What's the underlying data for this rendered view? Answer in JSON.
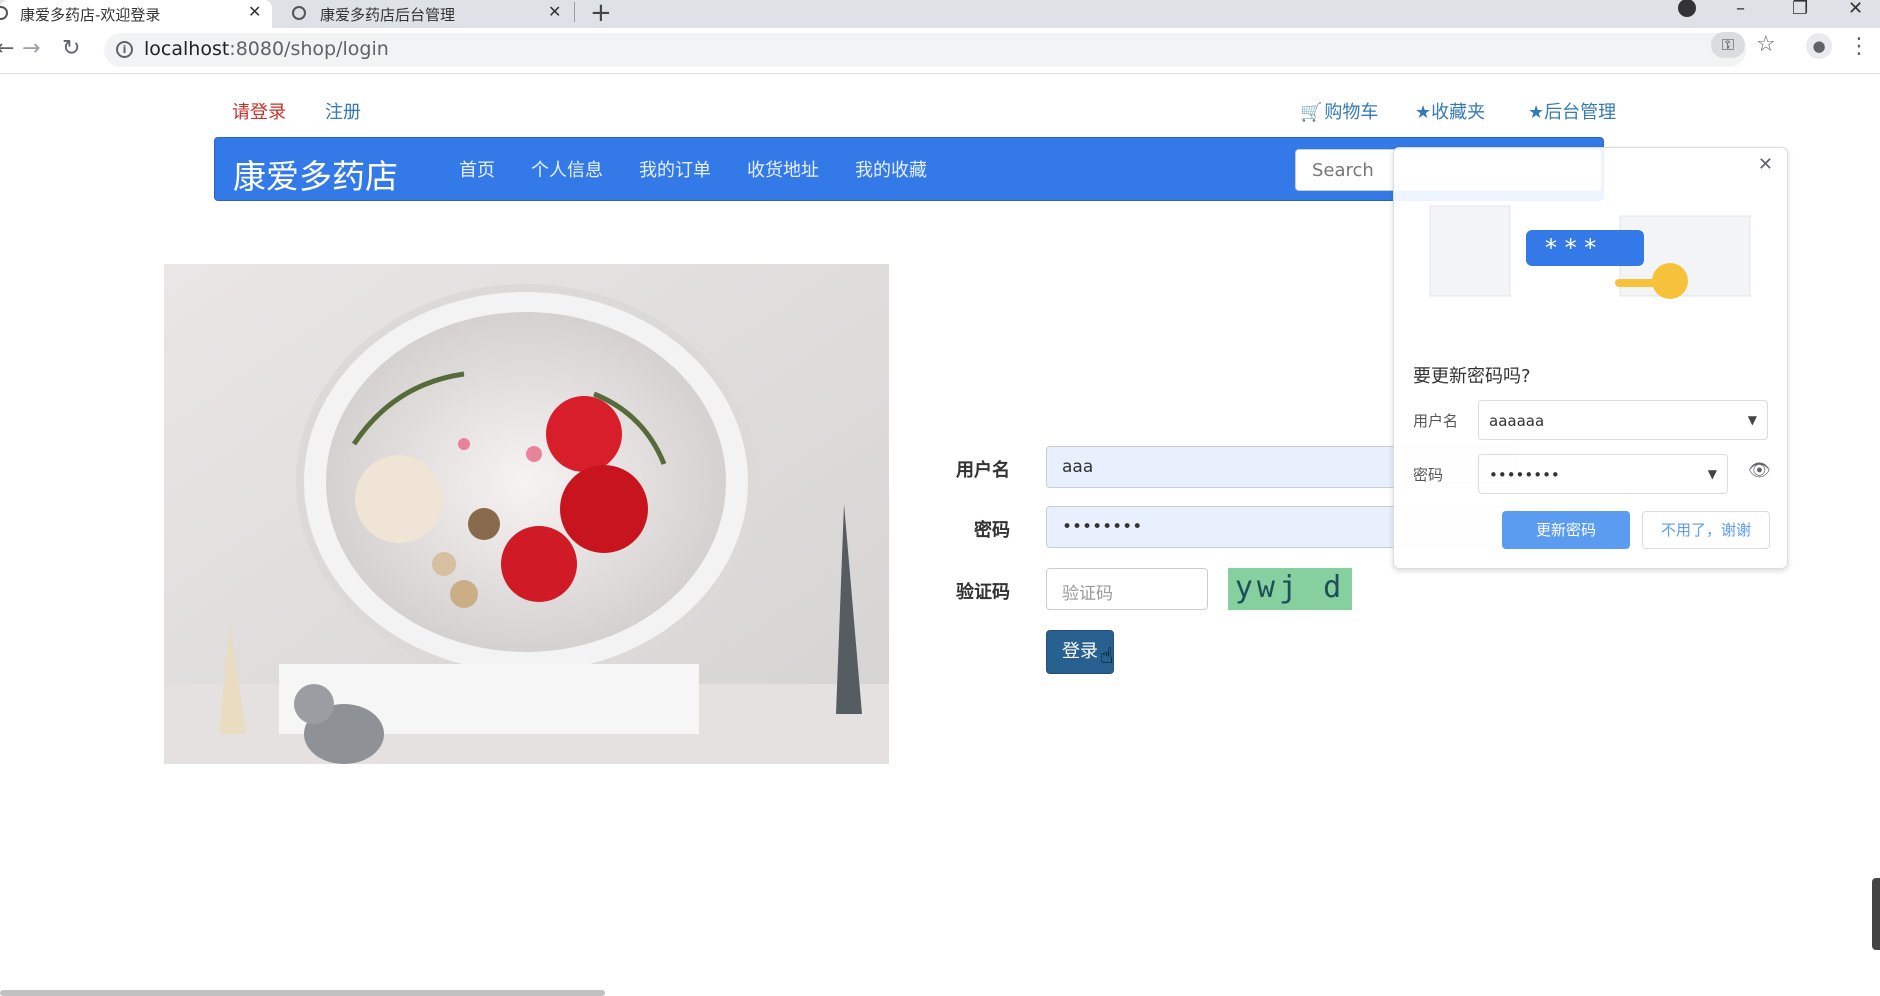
{
  "browser": {
    "tabs": [
      {
        "title": "康爱多药店-欢迎登录",
        "active": true
      },
      {
        "title": "康爱多药店后台管理",
        "active": false
      }
    ],
    "new_tab": "+",
    "url_host": "localhost",
    "url_path": ":8080/shop/login"
  },
  "top_links": {
    "login": "请登录",
    "register": "注册",
    "cart": "购物车",
    "favorites": "收藏夹",
    "admin": "后台管理"
  },
  "navbar": {
    "brand": "康爱多药店",
    "links": [
      "首页",
      "个人信息",
      "我的订单",
      "收货地址",
      "我的收藏"
    ],
    "search_placeholder": "Search"
  },
  "login_form": {
    "username_label": "用户名",
    "username_value": "aaa",
    "password_label": "密码",
    "password_value": "••••••••",
    "captcha_label": "验证码",
    "captcha_placeholder": "验证码",
    "captcha_text": "ywj d",
    "submit_label": "登录"
  },
  "password_prompt": {
    "title": "要更新密码吗?",
    "username_label": "用户名",
    "username_value": "aaaaaa",
    "password_label": "密码",
    "password_value": "••••••••",
    "update_button": "更新密码",
    "dismiss_button": "不用了，谢谢"
  },
  "colors": {
    "navbar_bg": "#337ae8",
    "login_link": "#c9302c",
    "link": "#337ab7",
    "login_button": "#286090",
    "captcha_bg": "#86cf9f"
  }
}
